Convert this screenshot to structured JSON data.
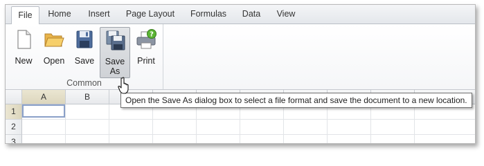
{
  "tabs": [
    {
      "label": "File",
      "active": true
    },
    {
      "label": "Home"
    },
    {
      "label": "Insert"
    },
    {
      "label": "Page Layout"
    },
    {
      "label": "Formulas"
    },
    {
      "label": "Data"
    },
    {
      "label": "View"
    }
  ],
  "ribbon": {
    "group_label": "Common",
    "buttons": [
      {
        "label": "New",
        "icon": "new-document-icon"
      },
      {
        "label": "Open",
        "icon": "open-folder-icon"
      },
      {
        "label": "Save",
        "icon": "floppy-disk-icon"
      },
      {
        "label": "Save As",
        "label_line1": "Save",
        "label_line2": "As",
        "icon": "save-as-icon",
        "hovered": true
      },
      {
        "label": "Print",
        "icon": "printer-help-icon"
      }
    ]
  },
  "tooltip": "Open the Save As dialog box to select a file format and save the document to a new location.",
  "grid": {
    "columns": [
      "A",
      "B"
    ],
    "rows": [
      "1",
      "2",
      "3"
    ],
    "active_cell": "A1"
  },
  "colors": {
    "selected_header": "#dcd6bd",
    "active_cell_border": "#8aa0c8",
    "tab_border": "#b9bec6"
  }
}
